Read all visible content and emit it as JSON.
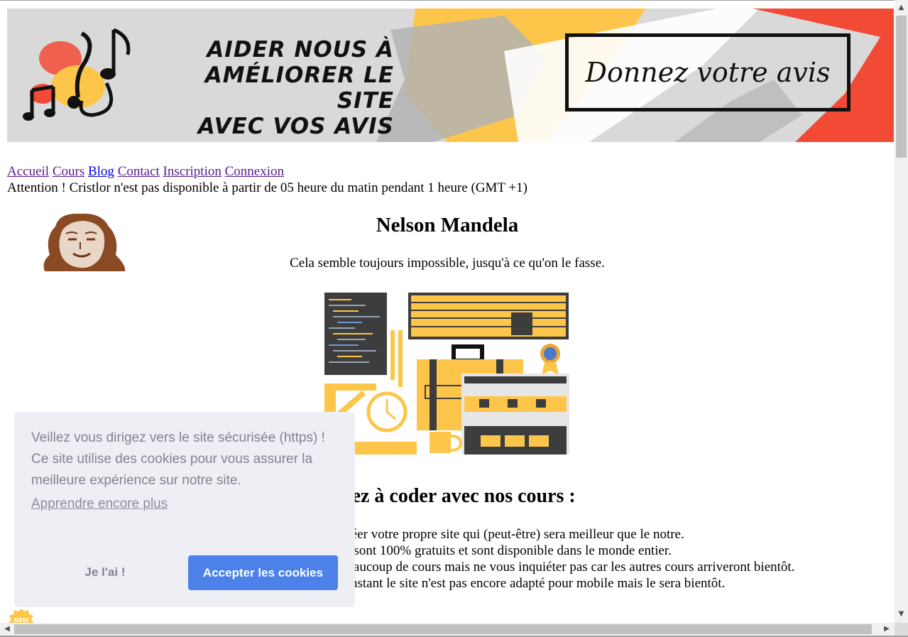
{
  "banner": {
    "headline_lines": [
      "AIDER NOUS À",
      "AMÉLIORER LE SITE",
      "AVEC VOS AVIS"
    ],
    "cta": "Donnez votre avis",
    "colors": {
      "yellow": "#fdc64a",
      "red": "#f24a35",
      "gray": "#b3b3b3",
      "bg": "#d9d9d9"
    },
    "icon": "music-notes-icon"
  },
  "nav": {
    "items": [
      {
        "label": "Accueil"
      },
      {
        "label": "Cours"
      },
      {
        "label": "Blog"
      },
      {
        "label": "Contact"
      },
      {
        "label": "Inscription"
      },
      {
        "label": "Connexion"
      }
    ]
  },
  "notice": "Attention ! Cristlor n'est pas disponible à partir de 05 heure du matin pendant 1 heure (GMT +1)",
  "quote": {
    "author": "Nelson Mandela",
    "text": "Cela semble toujours impossible, jusqu'à ce qu'on le fasse."
  },
  "cta": {
    "title": "nez à coder avec nos cours :",
    "lines": [
      "créer votre propre site qui (peut-être) sera meilleur que le notre.",
      "rs sont 100% gratuits et sont disponible dans le monde entier.",
      "beaucoup de cours mais ne vous inquiéter pas car les autres cours arriveront bientôt.",
      "l'instant le site n'est pas encore adapté pour mobile mais le sera bientôt."
    ]
  },
  "cookie": {
    "message_line1": "Veillez vous dirigez vers le site sécurisée (https) !",
    "message_line2": "Ce site utilise des cookies pour vous assurer la meilleure expérience sur notre site.",
    "learn_more": "Apprendre encore plus",
    "dismiss": "Je l'ai !",
    "accept": "Accepter les cookies",
    "accent_color": "#4b81e8"
  },
  "badge": "NEW"
}
